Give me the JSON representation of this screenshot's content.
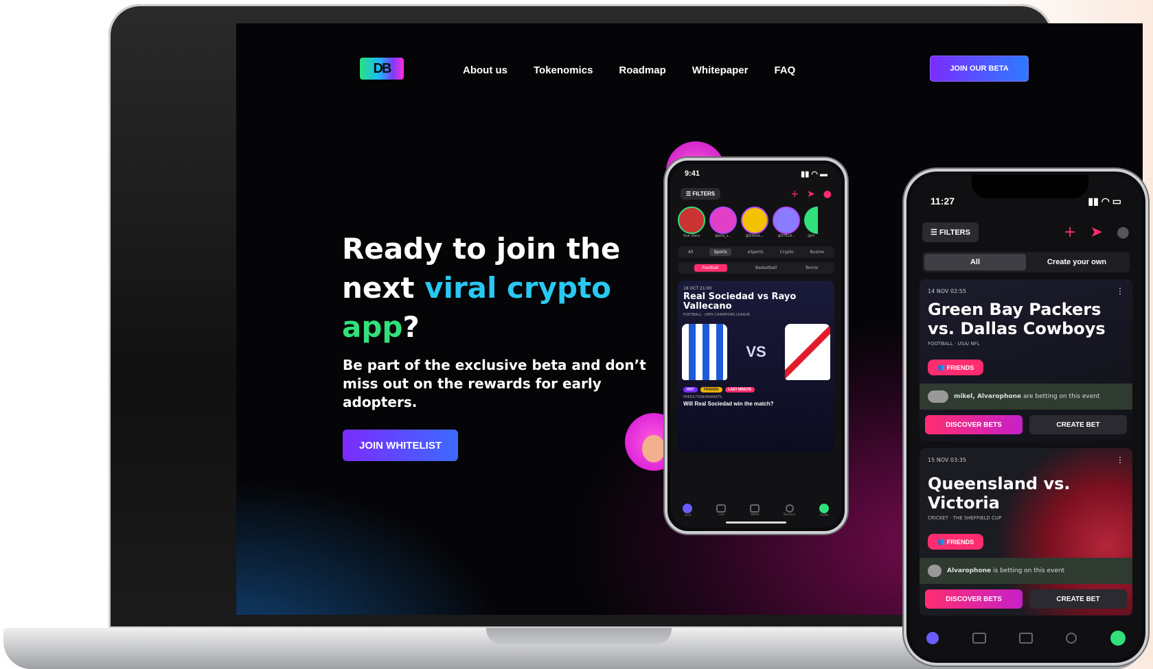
{
  "nav": {
    "logo_text": "DB",
    "links": [
      "About us",
      "Tokenomics",
      "Roadmap",
      "Whitepaper",
      "FAQ"
    ],
    "cta": "JOIN OUR BETA"
  },
  "hero": {
    "title_line1": "Ready to join the",
    "title_next": "next",
    "title_viral": "viral crypto",
    "title_app": "app",
    "title_q": "?",
    "subtitle": "Be part of the exclusive beta and don’t miss out on the rewards for early adopters.",
    "cta": "JOIN WHITELIST"
  },
  "phone_small": {
    "time": "9:41",
    "filters": "FILTERS",
    "story_labels": [
      "Your story",
      "@ella_s...",
      "@DillonL...",
      "@STELA...",
      "@m"
    ],
    "category_tabs": [
      "All",
      "Sports",
      "eSports",
      "Crypto",
      "Busine"
    ],
    "sub_tabs": [
      "Football",
      "Basketball",
      "Tennis"
    ],
    "event": {
      "date": "18 OCT 21:00",
      "title": "Real Sociedad vs Rayo Vallecano",
      "league": "FOOTBALL · UEFA CHAMPIONS LEAGUE",
      "vs": "VS",
      "tags": [
        "HOT",
        "FRIENDS",
        "LAST MINUTE"
      ],
      "prediction_label": "PREDICTION/MARKETS",
      "question": "Will Real Sociedad win the match?"
    },
    "bottom_tabs": [
      "Feed",
      "Live",
      "Wallet",
      "Discover",
      "Profile"
    ]
  },
  "phone_large": {
    "time": "11:27",
    "filters": "FILTERS",
    "tabs": [
      "All",
      "Create your own"
    ],
    "events": [
      {
        "date": "14 NOV 02:55",
        "title": "Green Bay Packers vs. Dallas Cowboys",
        "league": "FOOTBALL · USA/ NFL",
        "badge": "FRIENDS",
        "betting_users": "mikel, Alvarophone",
        "betting_suffix": " are betting on this event",
        "discover": "DISCOVER BETS",
        "create": "CREATE BET"
      },
      {
        "date": "15 NOV 03:35",
        "title": "Queensland vs. Victoria",
        "league": "CRICKET · THE SHEFFIELD CUP",
        "badge": "FRIENDS",
        "betting_users": "Alvarophone",
        "betting_suffix": " is betting on this event",
        "discover": "DISCOVER BETS",
        "create": "CREATE BET"
      }
    ]
  },
  "colors": {
    "accent_purple": "#7b2cff",
    "accent_blue": "#2c7bff",
    "cyan": "#29c8f2",
    "green": "#31e07a",
    "pink": "#ff2d6f",
    "magenta_glow": "#8c0c5c"
  }
}
